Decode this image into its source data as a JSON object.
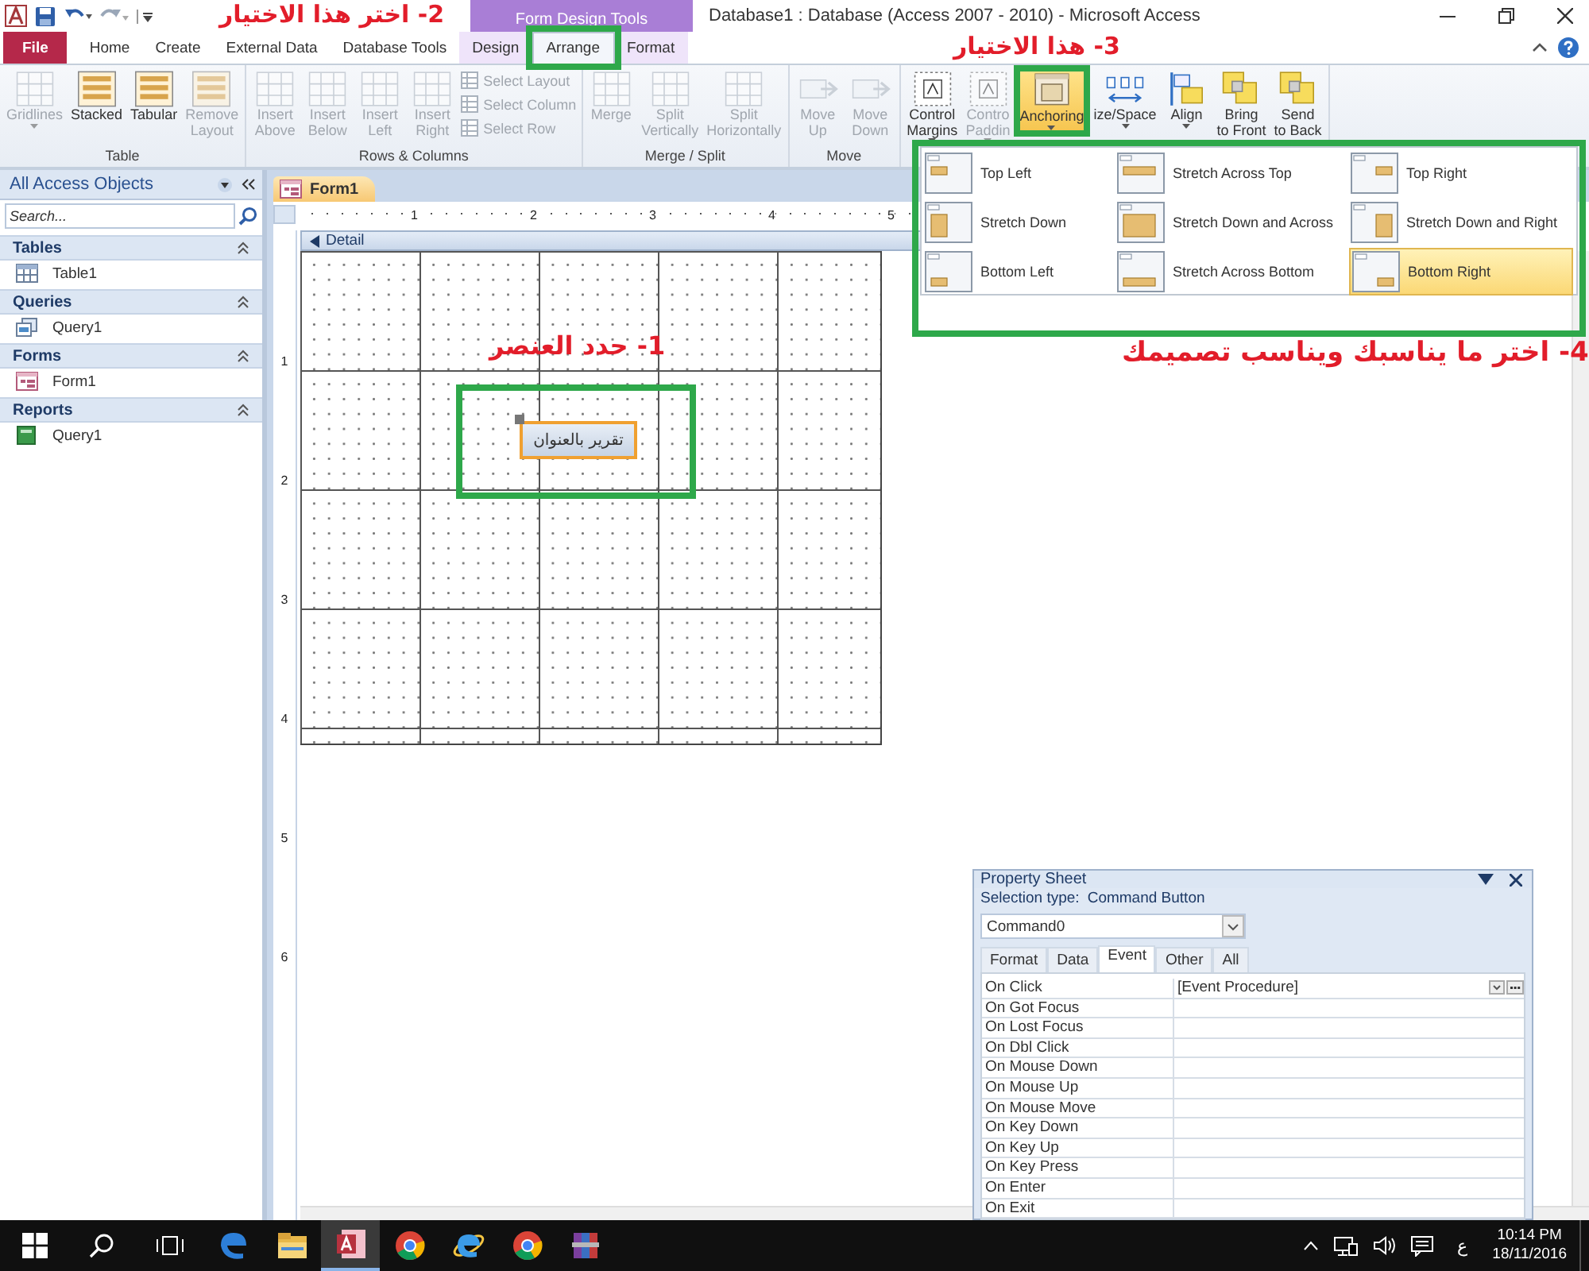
{
  "title_bar": {
    "context_label": "Form Design Tools",
    "title": "Database1 : Database (Access 2007 - 2010) - Microsoft Access"
  },
  "tabs": [
    {
      "label": "File",
      "kind": "file",
      "selected": false
    },
    {
      "label": "Home",
      "kind": "tab",
      "selected": false
    },
    {
      "label": "Create",
      "kind": "tab",
      "selected": false
    },
    {
      "label": "External Data",
      "kind": "tab",
      "selected": false
    },
    {
      "label": "Database Tools",
      "kind": "tab",
      "selected": false
    },
    {
      "label": "Design",
      "kind": "context",
      "selected": false
    },
    {
      "label": "Arrange",
      "kind": "context",
      "selected": true
    },
    {
      "label": "Format",
      "kind": "context",
      "selected": false
    }
  ],
  "ribbon": {
    "groups": [
      {
        "label": "Table",
        "items": [
          {
            "kind": "grid",
            "lines": [
              "Gridlines"
            ],
            "disabled": true,
            "dropdown": true
          },
          {
            "kind": "layout",
            "lines": [
              "Stacked"
            ],
            "disabled": false,
            "dropdown": false
          },
          {
            "kind": "layout",
            "lines": [
              "Tabular"
            ],
            "disabled": false,
            "dropdown": false
          },
          {
            "kind": "layout",
            "lines": [
              "Remove",
              "Layout"
            ],
            "disabled": true,
            "dropdown": false
          }
        ]
      },
      {
        "label": "Rows & Columns",
        "items": [
          {
            "kind": "grid",
            "lines": [
              "Insert",
              "Above"
            ],
            "disabled": true,
            "dropdown": false
          },
          {
            "kind": "grid",
            "lines": [
              "Insert",
              "Below"
            ],
            "disabled": true,
            "dropdown": false
          },
          {
            "kind": "grid",
            "lines": [
              "Insert",
              "Left"
            ],
            "disabled": true,
            "dropdown": false
          },
          {
            "kind": "grid",
            "lines": [
              "Insert",
              "Right"
            ],
            "disabled": true,
            "dropdown": false
          },
          {
            "kind": "small",
            "lines": [
              "Select Layout",
              "Select Column",
              "Select Row"
            ],
            "disabled": true,
            "dropdown": false
          }
        ]
      },
      {
        "label": "Merge / Split",
        "items": [
          {
            "kind": "grid",
            "lines": [
              "Merge"
            ],
            "disabled": true,
            "dropdown": false
          },
          {
            "kind": "grid",
            "lines": [
              "Split",
              "Vertically"
            ],
            "disabled": true,
            "dropdown": false
          },
          {
            "kind": "grid",
            "lines": [
              "Split",
              "Horizontally"
            ],
            "disabled": true,
            "dropdown": false
          }
        ]
      },
      {
        "label": "Move",
        "items": [
          {
            "kind": "move",
            "lines": [
              "Move",
              "Up"
            ],
            "disabled": true,
            "dropdown": false
          },
          {
            "kind": "move",
            "lines": [
              "Move",
              "Down"
            ],
            "disabled": true,
            "dropdown": false
          }
        ]
      },
      {
        "items": [
          {
            "kind": "margin",
            "lines": [
              "Control",
              "Margins"
            ],
            "disabled": false,
            "dropdown": true
          },
          {
            "kind": "margin",
            "lines": [
              "Contro",
              "Paddin"
            ],
            "disabled": true,
            "dropdown": true
          },
          {
            "kind": "anchor",
            "lines": [
              "Anchoring"
            ],
            "disabled": false,
            "dropdown": true,
            "selected": true
          },
          {
            "kind": "spacing",
            "lines": [
              "ize/Space"
            ],
            "disabled": false,
            "dropdown": true
          },
          {
            "kind": "align",
            "lines": [
              "Align"
            ],
            "disabled": false,
            "dropdown": true
          },
          {
            "kind": "order",
            "lines": [
              "Bring",
              "to Front"
            ],
            "disabled": false,
            "dropdown": false
          },
          {
            "kind": "order",
            "lines": [
              "Send",
              "to Back"
            ],
            "disabled": false,
            "dropdown": false
          }
        ]
      }
    ]
  },
  "anchoring_menu": {
    "options": [
      {
        "label": "Top Left",
        "selected": false
      },
      {
        "label": "Stretch Across Top",
        "selected": false
      },
      {
        "label": "Top Right",
        "selected": false
      },
      {
        "label": "Stretch Down",
        "selected": false
      },
      {
        "label": "Stretch Down and Across",
        "selected": false
      },
      {
        "label": "Stretch Down and Right",
        "selected": false
      },
      {
        "label": "Bottom Left",
        "selected": false
      },
      {
        "label": "Stretch Across Bottom",
        "selected": false
      },
      {
        "label": "Bottom Right",
        "selected": true
      }
    ]
  },
  "nav_pane": {
    "title": "All Access Objects",
    "search_placeholder": "Search...",
    "groups": [
      {
        "label": "Tables",
        "items": [
          {
            "label": "Table1",
            "kind": "table"
          }
        ]
      },
      {
        "label": "Queries",
        "items": [
          {
            "label": "Query1",
            "kind": "query"
          }
        ]
      },
      {
        "label": "Forms",
        "items": [
          {
            "label": "Form1",
            "kind": "form"
          }
        ]
      },
      {
        "label": "Reports",
        "items": [
          {
            "label": "Query1",
            "kind": "report"
          }
        ]
      }
    ]
  },
  "form_designer": {
    "tab": "Form1",
    "section": "Detail",
    "ruler_numbers": [
      "1",
      "2",
      "3",
      "4",
      "5"
    ],
    "vertical_ruler_numbers": [
      "1",
      "2",
      "3",
      "4",
      "5",
      "6"
    ],
    "control": {
      "caption": "تقرير بالعنوان",
      "selected": true
    }
  },
  "property_sheet": {
    "title": "Property Sheet",
    "selection_label": "Selection type:",
    "selection_type": "Command Button",
    "object": "Command0",
    "tabs": [
      {
        "label": "Format",
        "selected": false
      },
      {
        "label": "Data",
        "selected": false
      },
      {
        "label": "Event",
        "selected": true
      },
      {
        "label": "Other",
        "selected": false
      },
      {
        "label": "All",
        "selected": false
      }
    ],
    "rows": [
      {
        "name": "On Click",
        "value": "[Event Procedure]",
        "focused": true
      },
      {
        "name": "On Got Focus",
        "focused": false
      },
      {
        "name": "On Lost Focus",
        "focused": false
      },
      {
        "name": "On Dbl Click",
        "focused": false
      },
      {
        "name": "On Mouse Down",
        "focused": false
      },
      {
        "name": "On Mouse Up",
        "focused": false
      },
      {
        "name": "On Mouse Move",
        "focused": false
      },
      {
        "name": "On Key Down",
        "focused": false
      },
      {
        "name": "On Key Up",
        "focused": false
      },
      {
        "name": "On Key Press",
        "focused": false
      },
      {
        "name": "On Enter",
        "focused": false
      },
      {
        "name": "On Exit",
        "focused": false
      }
    ]
  },
  "annotations": [
    {
      "text": "1- حدد العنصر"
    },
    {
      "text": "2- اختر هذا الاختيار"
    },
    {
      "text": "3- هذا الاختيار"
    },
    {
      "text": "4- اختر ما يناسبك ويناسب تصميمك"
    }
  ],
  "taskbar": {
    "apps": [
      {
        "kind": "edge",
        "selected": false
      },
      {
        "kind": "folder",
        "selected": false
      },
      {
        "kind": "access",
        "selected": true
      },
      {
        "kind": "chrome",
        "selected": false
      },
      {
        "kind": "ie",
        "selected": false
      },
      {
        "kind": "chrome",
        "selected": false
      },
      {
        "kind": "winrar",
        "selected": false
      }
    ],
    "language": "ع",
    "time": "10:14 PM",
    "date": "18/11/2016"
  }
}
